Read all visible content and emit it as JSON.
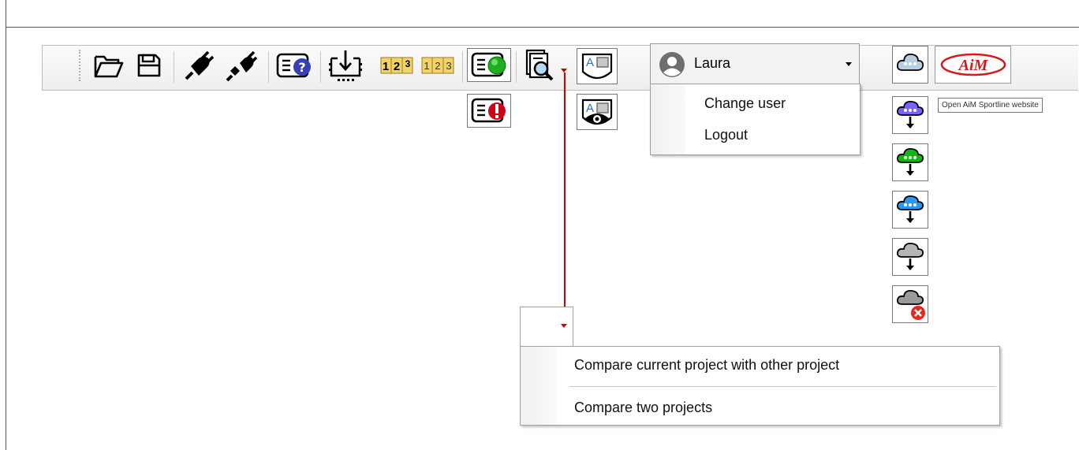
{
  "toolbar": {
    "buttons": [
      {
        "name": "open-folder-icon"
      },
      {
        "name": "save-icon"
      },
      {
        "name": "connect-plug-icon"
      },
      {
        "name": "disconnect-plug-icon"
      },
      {
        "name": "device-info-icon"
      },
      {
        "name": "download-icon"
      },
      {
        "name": "numbering-icon"
      },
      {
        "name": "numbering-disabled-icon"
      },
      {
        "name": "status-ok-icon"
      },
      {
        "name": "status-error-icon"
      },
      {
        "name": "compare-projects-icon"
      },
      {
        "name": "display-layout-icon"
      },
      {
        "name": "display-preview-icon"
      },
      {
        "name": "cloud-icon"
      },
      {
        "name": "aim-logo"
      }
    ],
    "numbers_label": "123"
  },
  "colors": {
    "menu_accent": "#cc0000",
    "status_ok": "#1fae1f",
    "status_error": "#d0021b",
    "cloud_purple": "#7b61ff",
    "cloud_green": "#11b811",
    "cloud_blue": "#2a97f0",
    "cloud_gray": "#9a9a9a",
    "cloud_error": "#e8261d"
  },
  "user": {
    "name": "Laura",
    "menu": [
      "Change user",
      "Logout"
    ]
  },
  "compare_menu": {
    "items": [
      "Compare current project with other project",
      "Compare two projects"
    ]
  },
  "cloud_actions": [
    {
      "name": "cloud-purple-download-icon",
      "color": "#7b61ff"
    },
    {
      "name": "cloud-green-download-icon",
      "color": "#11b811"
    },
    {
      "name": "cloud-blue-download-icon",
      "color": "#2a97f0"
    },
    {
      "name": "cloud-gray-download-icon",
      "color": "#9a9a9a"
    },
    {
      "name": "cloud-gray-error-icon",
      "color": "#9a9a9a"
    }
  ],
  "tooltip": "Open AiM Sportline website",
  "logo_text": "AiM"
}
